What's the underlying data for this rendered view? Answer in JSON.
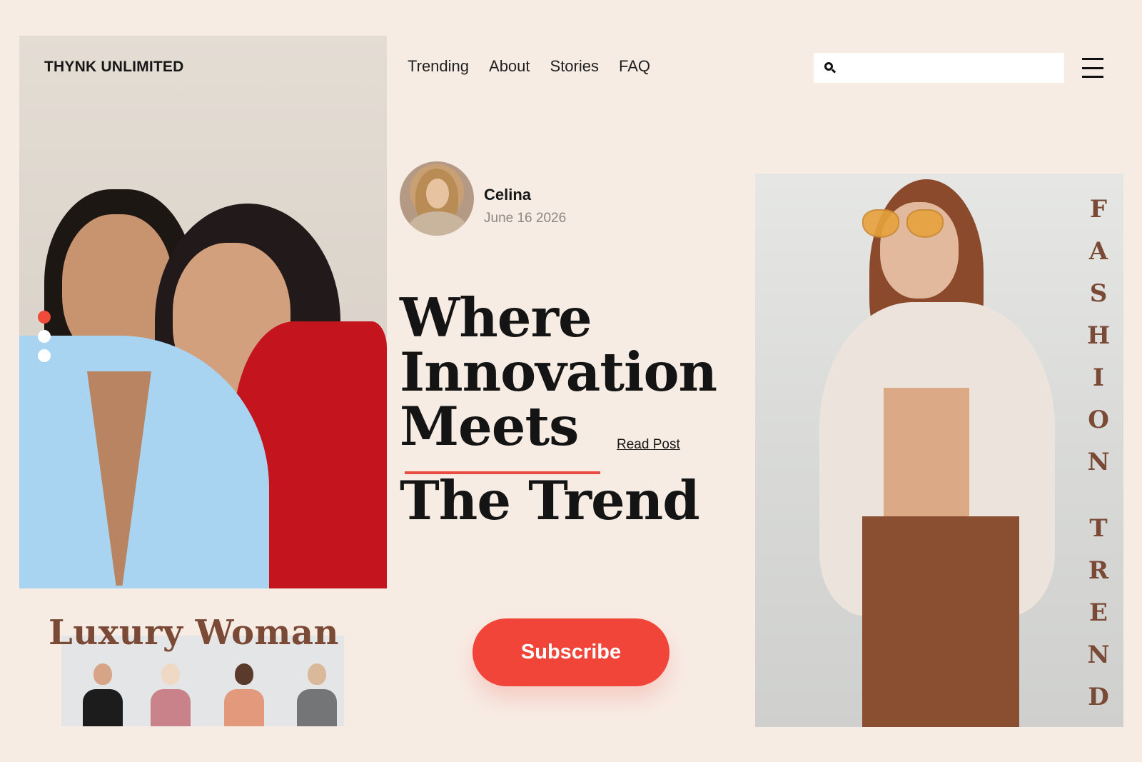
{
  "header": {
    "brand": "THYNK UNLIMITED",
    "nav": [
      "Trending",
      "About",
      "Stories",
      "FAQ"
    ],
    "search": {
      "value": "",
      "placeholder": "",
      "icon": "search-icon"
    },
    "menu_icon": "hamburger-menu-icon"
  },
  "carousel": {
    "slides": 3,
    "active_index": 0
  },
  "author": {
    "name": "Celina",
    "date": "June 16 2026"
  },
  "hero": {
    "headline_lines": [
      "Where",
      "Innovation",
      "Meets",
      "The Trend"
    ],
    "read_post": "Read Post",
    "subscribe": "Subscribe"
  },
  "feature": {
    "title": "Luxury Woman"
  },
  "side_text": "FASHION TREND",
  "colors": {
    "background": "#f7ece4",
    "accent_red": "#f1453a",
    "brown": "#7a4a36",
    "text": "#161616"
  }
}
